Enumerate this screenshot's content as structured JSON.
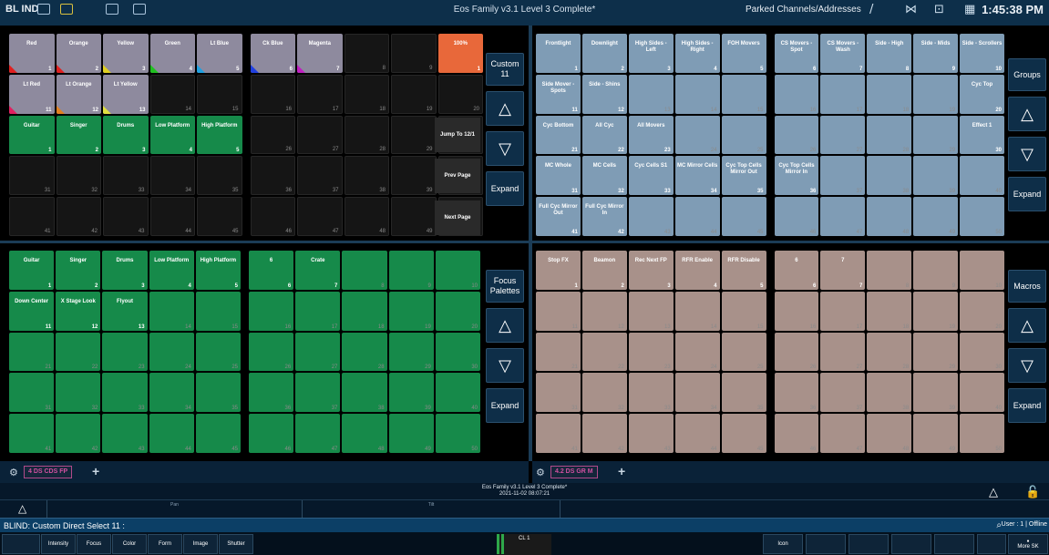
{
  "topbar": {
    "mode": "BL IND",
    "title": "Eos Family v3.1 Level 3 Complete*",
    "parked": "Parked Channels/Addresses",
    "time": "1:45:38 PM"
  },
  "colors": {
    "palette_gray": "#8e8a9e",
    "orange": "#e8683a",
    "green": "#168a4a",
    "blue": "#7f9cb5",
    "brown": "#a8918a",
    "navy": "#0e2e48"
  },
  "tl_grid": {
    "cells": [
      {
        "l": "Red",
        "n": "1",
        "c": "gray",
        "t": "#e02020"
      },
      {
        "l": "Orange",
        "n": "2",
        "c": "gray",
        "t": "#e02020"
      },
      {
        "l": "Yellow",
        "n": "3",
        "c": "gray",
        "t": "#e0d020"
      },
      {
        "l": "Green",
        "n": "4",
        "c": "gray",
        "t": "#20c020"
      },
      {
        "l": "Lt Blue",
        "n": "5",
        "c": "gray",
        "t": "#20a0e0"
      },
      {
        "l": "Ck Blue",
        "n": "6",
        "c": "gray",
        "t": "#2040e0"
      },
      {
        "l": "Magenta",
        "n": "7",
        "c": "gray",
        "t": "#c020c0"
      },
      {
        "l": "",
        "n": "8",
        "c": "empty"
      },
      {
        "l": "",
        "n": "9",
        "c": "empty"
      },
      {
        "l": "100%",
        "n": "1",
        "c": "orange"
      },
      {
        "l": "Lt Red",
        "n": "11",
        "c": "gray",
        "t": "#e02060"
      },
      {
        "l": "Lt Orange",
        "n": "12",
        "c": "gray",
        "t": "#e08020"
      },
      {
        "l": "Lt Yellow",
        "n": "13",
        "c": "gray",
        "t": "#e0e040"
      },
      {
        "l": "",
        "n": "14",
        "c": "empty"
      },
      {
        "l": "",
        "n": "15",
        "c": "empty"
      },
      {
        "l": "",
        "n": "16",
        "c": "empty"
      },
      {
        "l": "",
        "n": "17",
        "c": "empty"
      },
      {
        "l": "",
        "n": "18",
        "c": "empty"
      },
      {
        "l": "",
        "n": "19",
        "c": "empty"
      },
      {
        "l": "",
        "n": "20",
        "c": "empty"
      },
      {
        "l": "Guitar",
        "n": "1",
        "c": "green"
      },
      {
        "l": "Singer",
        "n": "2",
        "c": "green"
      },
      {
        "l": "Drums",
        "n": "3",
        "c": "green"
      },
      {
        "l": "Low Platform",
        "n": "4",
        "c": "green"
      },
      {
        "l": "High Platform",
        "n": "5",
        "c": "green"
      },
      {
        "l": "",
        "n": "26",
        "c": "empty"
      },
      {
        "l": "",
        "n": "27",
        "c": "empty"
      },
      {
        "l": "",
        "n": "28",
        "c": "empty"
      },
      {
        "l": "",
        "n": "29",
        "c": "empty"
      },
      {
        "l": "",
        "n": "30",
        "c": "empty"
      },
      {
        "l": "",
        "n": "31",
        "c": "empty"
      },
      {
        "l": "",
        "n": "32",
        "c": "empty"
      },
      {
        "l": "",
        "n": "33",
        "c": "empty"
      },
      {
        "l": "",
        "n": "34",
        "c": "empty"
      },
      {
        "l": "",
        "n": "35",
        "c": "empty"
      },
      {
        "l": "",
        "n": "36",
        "c": "empty"
      },
      {
        "l": "",
        "n": "37",
        "c": "empty"
      },
      {
        "l": "",
        "n": "38",
        "c": "empty"
      },
      {
        "l": "",
        "n": "39",
        "c": "empty"
      },
      {
        "l": "",
        "n": "40",
        "c": "empty"
      },
      {
        "l": "",
        "n": "41",
        "c": "empty"
      },
      {
        "l": "",
        "n": "42",
        "c": "empty"
      },
      {
        "l": "",
        "n": "43",
        "c": "empty"
      },
      {
        "l": "",
        "n": "44",
        "c": "empty"
      },
      {
        "l": "",
        "n": "45",
        "c": "empty"
      },
      {
        "l": "",
        "n": "46",
        "c": "empty"
      },
      {
        "l": "",
        "n": "47",
        "c": "empty"
      },
      {
        "l": "",
        "n": "48",
        "c": "empty"
      },
      {
        "l": "",
        "n": "49",
        "c": "empty"
      },
      {
        "l": "",
        "n": "50",
        "c": "empty"
      }
    ],
    "mid_buttons": [
      "Jump To 12/1",
      "Prev Page",
      "Next Page"
    ],
    "side": {
      "title": "Custom\n11",
      "expand": "Expand"
    }
  },
  "tr_grid": {
    "cells": [
      {
        "l": "Frontlight",
        "n": "1",
        "c": "blue"
      },
      {
        "l": "Downlight",
        "n": "2",
        "c": "blue"
      },
      {
        "l": "High Sides - Left",
        "n": "3",
        "c": "blue"
      },
      {
        "l": "High Sides - Right",
        "n": "4",
        "c": "blue"
      },
      {
        "l": "FOH Movers",
        "n": "5",
        "c": "blue"
      },
      {
        "l": "CS Movers - Spot",
        "n": "6",
        "c": "blue"
      },
      {
        "l": "CS Movers - Wash",
        "n": "7",
        "c": "blue"
      },
      {
        "l": "Side - High",
        "n": "8",
        "c": "blue"
      },
      {
        "l": "Side - Mids",
        "n": "9",
        "c": "blue"
      },
      {
        "l": "Side - Scrollers",
        "n": "10",
        "c": "blue"
      },
      {
        "l": "Side Mover - Spots",
        "n": "11",
        "c": "blue"
      },
      {
        "l": "Side - Shins",
        "n": "12",
        "c": "blue"
      },
      {
        "l": "",
        "n": "13",
        "c": "blue"
      },
      {
        "l": "",
        "n": "14",
        "c": "blue"
      },
      {
        "l": "",
        "n": "15",
        "c": "blue"
      },
      {
        "l": "",
        "n": "16",
        "c": "blue"
      },
      {
        "l": "",
        "n": "17",
        "c": "blue"
      },
      {
        "l": "",
        "n": "18",
        "c": "blue"
      },
      {
        "l": "",
        "n": "19",
        "c": "blue"
      },
      {
        "l": "Cyc Top",
        "n": "20",
        "c": "blue"
      },
      {
        "l": "Cyc Bottom",
        "n": "21",
        "c": "blue"
      },
      {
        "l": "All Cyc",
        "n": "22",
        "c": "blue"
      },
      {
        "l": "All Movers",
        "n": "23",
        "c": "blue"
      },
      {
        "l": "",
        "n": "24",
        "c": "blue"
      },
      {
        "l": "",
        "n": "25",
        "c": "blue"
      },
      {
        "l": "",
        "n": "26",
        "c": "blue"
      },
      {
        "l": "",
        "n": "27",
        "c": "blue"
      },
      {
        "l": "",
        "n": "28",
        "c": "blue"
      },
      {
        "l": "",
        "n": "29",
        "c": "blue"
      },
      {
        "l": "Effect 1",
        "n": "30",
        "c": "blue"
      },
      {
        "l": "MC Whole",
        "n": "31",
        "c": "blue"
      },
      {
        "l": "MC Cells",
        "n": "32",
        "c": "blue"
      },
      {
        "l": "Cyc Cells S1",
        "n": "33",
        "c": "blue"
      },
      {
        "l": "MC Mirror Cells",
        "n": "34",
        "c": "blue"
      },
      {
        "l": "Cyc Top Cells Mirror Out",
        "n": "35",
        "c": "blue"
      },
      {
        "l": "Cyc Top Cells Mirror In",
        "n": "36",
        "c": "blue"
      },
      {
        "l": "",
        "n": "37",
        "c": "blue"
      },
      {
        "l": "",
        "n": "38",
        "c": "blue"
      },
      {
        "l": "",
        "n": "39",
        "c": "blue"
      },
      {
        "l": "",
        "n": "40",
        "c": "blue"
      },
      {
        "l": "Full Cyc Mirror Out",
        "n": "41",
        "c": "blue"
      },
      {
        "l": "Full Cyc Mirror In",
        "n": "42",
        "c": "blue"
      },
      {
        "l": "",
        "n": "43",
        "c": "blue"
      },
      {
        "l": "",
        "n": "44",
        "c": "blue"
      },
      {
        "l": "",
        "n": "45",
        "c": "blue"
      },
      {
        "l": "",
        "n": "46",
        "c": "blue"
      },
      {
        "l": "",
        "n": "47",
        "c": "blue"
      },
      {
        "l": "",
        "n": "48",
        "c": "blue"
      },
      {
        "l": "",
        "n": "49",
        "c": "blue"
      },
      {
        "l": "",
        "n": "50",
        "c": "blue"
      }
    ],
    "side": {
      "title": "Groups",
      "expand": "Expand"
    }
  },
  "bl_grid": {
    "cells": [
      {
        "l": "Guitar",
        "n": "1",
        "c": "green"
      },
      {
        "l": "Singer",
        "n": "2",
        "c": "green"
      },
      {
        "l": "Drums",
        "n": "3",
        "c": "green"
      },
      {
        "l": "Low Platform",
        "n": "4",
        "c": "green"
      },
      {
        "l": "High Platform",
        "n": "5",
        "c": "green"
      },
      {
        "l": "6",
        "n": "6",
        "c": "green"
      },
      {
        "l": "Crate",
        "n": "7",
        "c": "green"
      },
      {
        "l": "",
        "n": "8",
        "c": "green"
      },
      {
        "l": "",
        "n": "9",
        "c": "green"
      },
      {
        "l": "",
        "n": "10",
        "c": "green"
      },
      {
        "l": "Down Center",
        "n": "11",
        "c": "green"
      },
      {
        "l": "X Stage Look",
        "n": "12",
        "c": "green"
      },
      {
        "l": "Flyout",
        "n": "13",
        "c": "green"
      },
      {
        "l": "",
        "n": "14",
        "c": "green"
      },
      {
        "l": "",
        "n": "15",
        "c": "green"
      },
      {
        "l": "",
        "n": "16",
        "c": "green"
      },
      {
        "l": "",
        "n": "17",
        "c": "green"
      },
      {
        "l": "",
        "n": "18",
        "c": "green"
      },
      {
        "l": "",
        "n": "19",
        "c": "green"
      },
      {
        "l": "",
        "n": "20",
        "c": "green"
      },
      {
        "l": "",
        "n": "21",
        "c": "green"
      },
      {
        "l": "",
        "n": "22",
        "c": "green"
      },
      {
        "l": "",
        "n": "23",
        "c": "green"
      },
      {
        "l": "",
        "n": "24",
        "c": "green"
      },
      {
        "l": "",
        "n": "25",
        "c": "green"
      },
      {
        "l": "",
        "n": "26",
        "c": "green"
      },
      {
        "l": "",
        "n": "27",
        "c": "green"
      },
      {
        "l": "",
        "n": "28",
        "c": "green"
      },
      {
        "l": "",
        "n": "29",
        "c": "green"
      },
      {
        "l": "",
        "n": "30",
        "c": "green"
      },
      {
        "l": "",
        "n": "31",
        "c": "green"
      },
      {
        "l": "",
        "n": "32",
        "c": "green"
      },
      {
        "l": "",
        "n": "33",
        "c": "green"
      },
      {
        "l": "",
        "n": "34",
        "c": "green"
      },
      {
        "l": "",
        "n": "35",
        "c": "green"
      },
      {
        "l": "",
        "n": "36",
        "c": "green"
      },
      {
        "l": "",
        "n": "37",
        "c": "green"
      },
      {
        "l": "",
        "n": "38",
        "c": "green"
      },
      {
        "l": "",
        "n": "39",
        "c": "green"
      },
      {
        "l": "",
        "n": "40",
        "c": "green"
      },
      {
        "l": "",
        "n": "41",
        "c": "green"
      },
      {
        "l": "",
        "n": "42",
        "c": "green"
      },
      {
        "l": "",
        "n": "43",
        "c": "green"
      },
      {
        "l": "",
        "n": "44",
        "c": "green"
      },
      {
        "l": "",
        "n": "45",
        "c": "green"
      },
      {
        "l": "",
        "n": "46",
        "c": "green"
      },
      {
        "l": "",
        "n": "47",
        "c": "green"
      },
      {
        "l": "",
        "n": "48",
        "c": "green"
      },
      {
        "l": "",
        "n": "49",
        "c": "green"
      },
      {
        "l": "",
        "n": "50",
        "c": "green"
      }
    ],
    "side": {
      "title": "Focus\nPalettes",
      "expand": "Expand"
    }
  },
  "br_grid": {
    "cells": [
      {
        "l": "Stop FX",
        "n": "1",
        "c": "brown"
      },
      {
        "l": "Beamon",
        "n": "2",
        "c": "brown"
      },
      {
        "l": "Rec Next FP",
        "n": "3",
        "c": "brown"
      },
      {
        "l": "RFR Enable",
        "n": "4",
        "c": "brown"
      },
      {
        "l": "RFR Disable",
        "n": "5",
        "c": "brown"
      },
      {
        "l": "6",
        "n": "6",
        "c": "brown"
      },
      {
        "l": "7",
        "n": "7",
        "c": "brown"
      },
      {
        "l": "",
        "n": "8",
        "c": "brown"
      },
      {
        "l": "",
        "n": "9",
        "c": "brown"
      },
      {
        "l": "",
        "n": "10",
        "c": "brown"
      },
      {
        "l": "",
        "n": "11",
        "c": "brown"
      },
      {
        "l": "",
        "n": "12",
        "c": "brown"
      },
      {
        "l": "",
        "n": "13",
        "c": "brown"
      },
      {
        "l": "",
        "n": "14",
        "c": "brown"
      },
      {
        "l": "",
        "n": "15",
        "c": "brown"
      },
      {
        "l": "",
        "n": "16",
        "c": "brown"
      },
      {
        "l": "",
        "n": "17",
        "c": "brown"
      },
      {
        "l": "",
        "n": "18",
        "c": "brown"
      },
      {
        "l": "",
        "n": "19",
        "c": "brown"
      },
      {
        "l": "",
        "n": "20",
        "c": "brown"
      },
      {
        "l": "",
        "n": "21",
        "c": "brown"
      },
      {
        "l": "",
        "n": "22",
        "c": "brown"
      },
      {
        "l": "",
        "n": "23",
        "c": "brown"
      },
      {
        "l": "",
        "n": "24",
        "c": "brown"
      },
      {
        "l": "",
        "n": "25",
        "c": "brown"
      },
      {
        "l": "",
        "n": "26",
        "c": "brown"
      },
      {
        "l": "",
        "n": "27",
        "c": "brown"
      },
      {
        "l": "",
        "n": "28",
        "c": "brown"
      },
      {
        "l": "",
        "n": "29",
        "c": "brown"
      },
      {
        "l": "",
        "n": "30",
        "c": "brown"
      },
      {
        "l": "",
        "n": "31",
        "c": "brown"
      },
      {
        "l": "",
        "n": "32",
        "c": "brown"
      },
      {
        "l": "",
        "n": "33",
        "c": "brown"
      },
      {
        "l": "",
        "n": "34",
        "c": "brown"
      },
      {
        "l": "",
        "n": "35",
        "c": "brown"
      },
      {
        "l": "",
        "n": "36",
        "c": "brown"
      },
      {
        "l": "",
        "n": "37",
        "c": "brown"
      },
      {
        "l": "",
        "n": "38",
        "c": "brown"
      },
      {
        "l": "",
        "n": "39",
        "c": "brown"
      },
      {
        "l": "",
        "n": "40",
        "c": "brown"
      },
      {
        "l": "",
        "n": "41",
        "c": "brown"
      },
      {
        "l": "",
        "n": "42",
        "c": "brown"
      },
      {
        "l": "",
        "n": "43",
        "c": "brown"
      },
      {
        "l": "",
        "n": "44",
        "c": "brown"
      },
      {
        "l": "",
        "n": "45",
        "c": "brown"
      },
      {
        "l": "",
        "n": "46",
        "c": "brown"
      },
      {
        "l": "",
        "n": "47",
        "c": "brown"
      },
      {
        "l": "",
        "n": "48",
        "c": "brown"
      },
      {
        "l": "",
        "n": "49",
        "c": "brown"
      },
      {
        "l": "",
        "n": "50",
        "c": "brown"
      }
    ],
    "side": {
      "title": "Macros",
      "expand": "Expand"
    }
  },
  "tabs": {
    "left": "4 DS CDS FP",
    "right": "4.2 DS GR M"
  },
  "info": {
    "title": "Eos Family v3.1 Level 3 Complete*",
    "date": "2021-11-02 08:07:21"
  },
  "fader": {
    "pan": "Pan",
    "tilt": "Tilt"
  },
  "cmdline": {
    "text": "BLIND: Custom Direct Select  11 :",
    "user": "User : 1 | Offline"
  },
  "softkeys": [
    "Intensity",
    "Focus",
    "Color",
    "Form",
    "Image",
    "Shutter"
  ],
  "softkeys_right": {
    "icon": "Icon",
    "more": "More SK"
  },
  "encoder": {
    "label": "CL 1"
  }
}
